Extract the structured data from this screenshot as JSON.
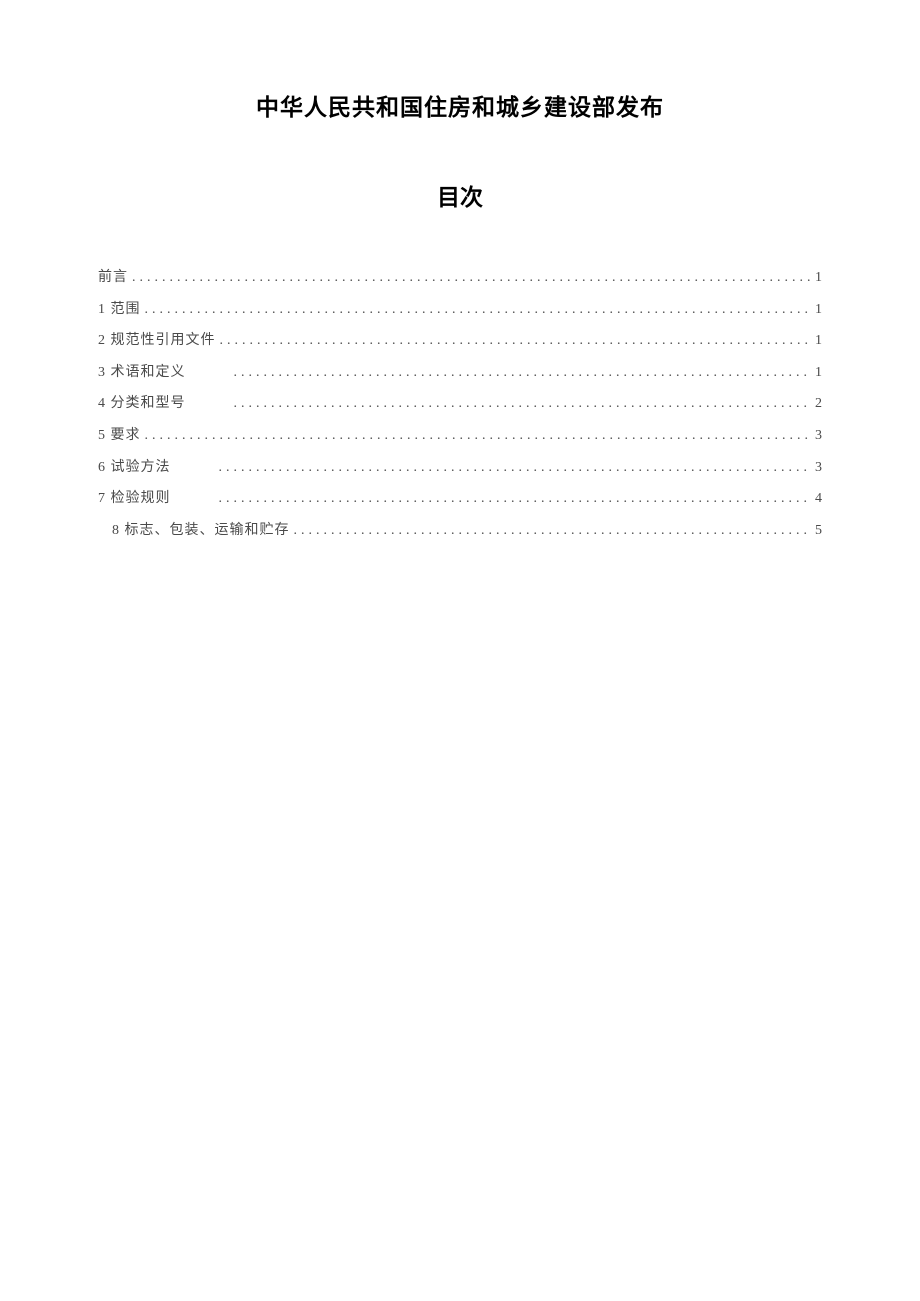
{
  "title": "中华人民共和国住房和城乡建设部发布",
  "subtitle": "目次",
  "toc": [
    {
      "label": "前言",
      "page": "1",
      "gap": false,
      "indent": false
    },
    {
      "label": "1 范围",
      "page": "1",
      "gap": false,
      "indent": false
    },
    {
      "label": "2 规范性引用文件",
      "page": "1",
      "gap": false,
      "indent": false
    },
    {
      "label": "3 术语和定义",
      "page": "1",
      "gap": true,
      "indent": false
    },
    {
      "label": "4 分类和型号",
      "page": "2",
      "gap": true,
      "indent": false
    },
    {
      "label": "5 要求",
      "page": "3",
      "gap": false,
      "indent": false
    },
    {
      "label": "6 试验方法",
      "page": "3",
      "gap": true,
      "indent": false
    },
    {
      "label": "7 检验规则",
      "page": "4",
      "gap": true,
      "indent": false
    },
    {
      "label": "8 标志、包装、运输和贮存",
      "page": "5",
      "gap": false,
      "indent": true
    }
  ]
}
